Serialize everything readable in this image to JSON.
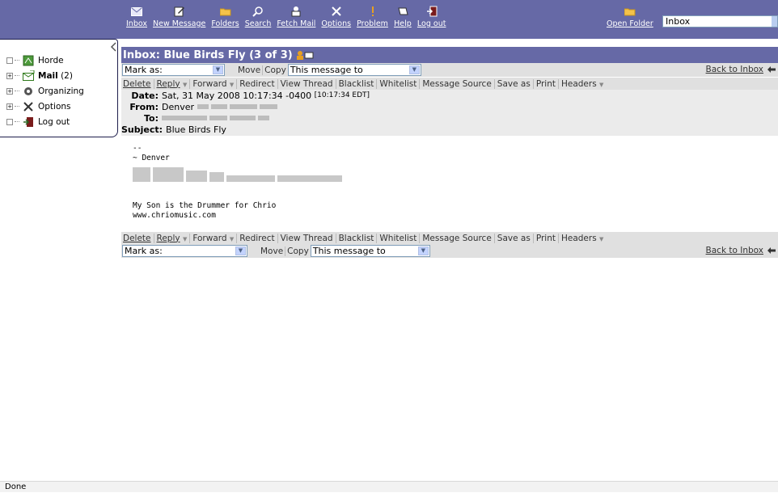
{
  "toolbar": {
    "items": [
      {
        "label": "Inbox",
        "icon": "envelope-icon"
      },
      {
        "label": "New Message",
        "icon": "compose-icon"
      },
      {
        "label": "Folders",
        "icon": "folder-icon"
      },
      {
        "label": "Search",
        "icon": "search-icon"
      },
      {
        "label": "Fetch Mail",
        "icon": "fetch-mail-icon"
      },
      {
        "label": "Options",
        "icon": "options-icon"
      },
      {
        "label": "Problem",
        "icon": "problem-icon"
      },
      {
        "label": "Help",
        "icon": "help-icon"
      },
      {
        "label": "Log out",
        "icon": "logout-icon"
      }
    ],
    "open_folder": "Open Folder",
    "folder_select": "Inbox"
  },
  "sidebar": {
    "items": [
      {
        "label": "Horde"
      },
      {
        "label": "Mail",
        "count": "(2)"
      },
      {
        "label": "Organizing"
      },
      {
        "label": "Options"
      },
      {
        "label": "Log out"
      }
    ]
  },
  "message": {
    "title": "Inbox: Blue Birds Fly (3 of 3)",
    "mark_as": "Mark as:",
    "move": "Move",
    "copy": "Copy",
    "target": "This message to",
    "back_to_inbox": "Back to Inbox",
    "actions": [
      "Delete",
      "Reply",
      "Forward",
      "Redirect",
      "View Thread",
      "Blacklist",
      "Whitelist",
      "Message Source",
      "Save as",
      "Print",
      "Headers"
    ],
    "headers": {
      "date_label": "Date:",
      "date": "Sat, 31 May 2008 10:17:34 -0400",
      "date_local": "[10:17:34 EDT]",
      "from_label": "From:",
      "from": "Denver",
      "to_label": "To:",
      "subject_label": "Subject:",
      "subject": "Blue Birds Fly"
    },
    "body": {
      "sig_sep": "--",
      "sig_name": "~ Denver",
      "line1": "My Son is the Drummer for Chrio",
      "line2": "www.chriomusic.com"
    }
  },
  "status": "Done",
  "colors": {
    "accent": "#6669a6",
    "bar": "#e0e0e0",
    "headers": "#ebebeb"
  }
}
